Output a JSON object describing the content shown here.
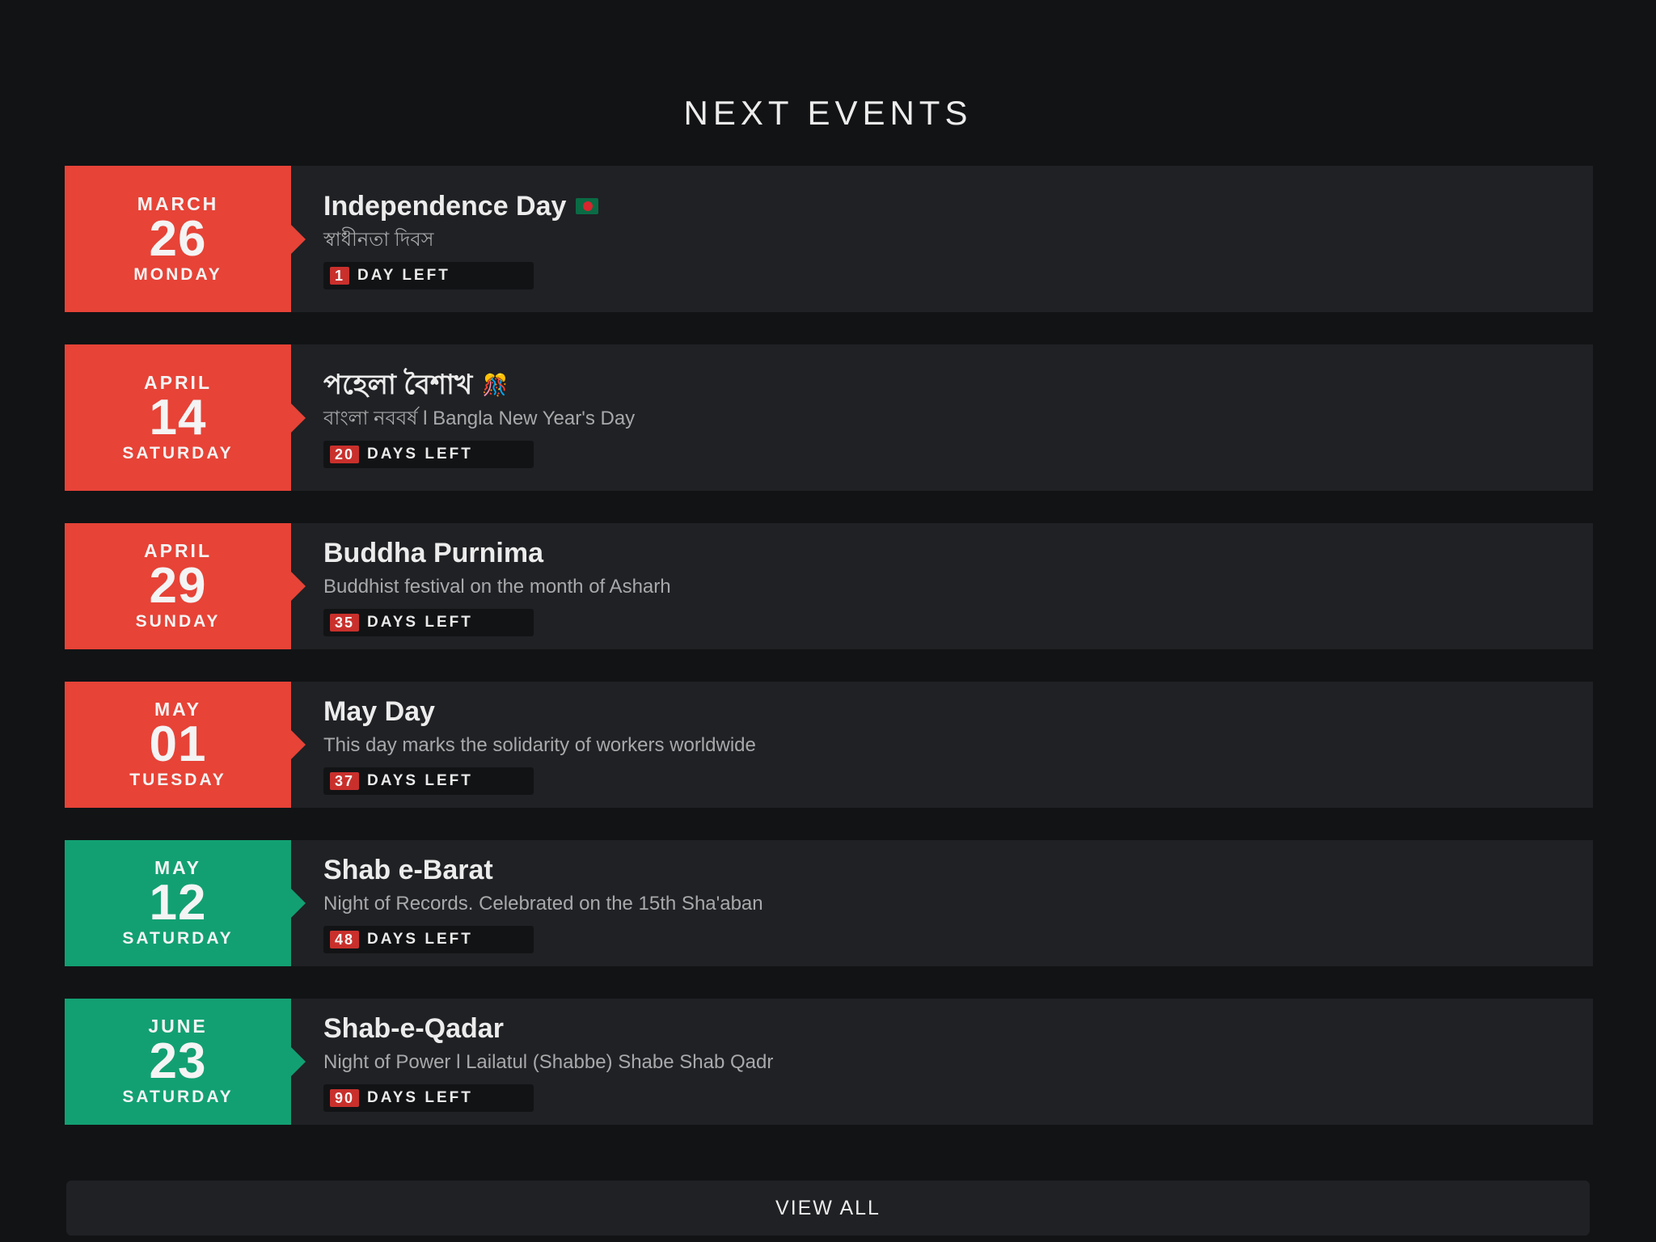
{
  "page_title": "NEXT EVENTS",
  "colors": {
    "red_accent": "#e74337",
    "green_accent": "#12a072",
    "badge_red": "#c9302c",
    "background": "#121315",
    "card": "#202124"
  },
  "events": [
    {
      "month": "MARCH",
      "day": "26",
      "weekday": "MONDAY",
      "title": "Independence Day",
      "icon": "bangladesh-flag-icon",
      "description": "স্বাধীনতা দিবস",
      "count": "1",
      "count_label": "DAY LEFT",
      "accent": "red"
    },
    {
      "month": "APRIL",
      "day": "14",
      "weekday": "SATURDAY",
      "title": "পহেলা বৈশাখ",
      "icon": "celebration-icon",
      "description": "বাংলা নববর্ষ l Bangla New Year's Day",
      "count": "20",
      "count_label": "DAYS LEFT",
      "accent": "red"
    },
    {
      "month": "APRIL",
      "day": "29",
      "weekday": "SUNDAY",
      "title": "Buddha Purnima",
      "description": "Buddhist festival on the month of Asharh",
      "count": "35",
      "count_label": "DAYS LEFT",
      "accent": "red"
    },
    {
      "month": "MAY",
      "day": "01",
      "weekday": "TUESDAY",
      "title": "May Day",
      "description": "This day marks the solidarity of workers worldwide",
      "count": "37",
      "count_label": "DAYS LEFT",
      "accent": "red"
    },
    {
      "month": "MAY",
      "day": "12",
      "weekday": "SATURDAY",
      "title": "Shab e-Barat",
      "description": "Night of Records. Celebrated on the 15th Sha'aban",
      "count": "48",
      "count_label": "DAYS LEFT",
      "accent": "green"
    },
    {
      "month": "JUNE",
      "day": "23",
      "weekday": "SATURDAY",
      "title": "Shab-e-Qadar",
      "description": "Night of Power l Lailatul (Shabbe) Shabe Shab Qadr",
      "count": "90",
      "count_label": "DAYS LEFT",
      "accent": "green"
    }
  ],
  "view_all_label": "VIEW ALL"
}
